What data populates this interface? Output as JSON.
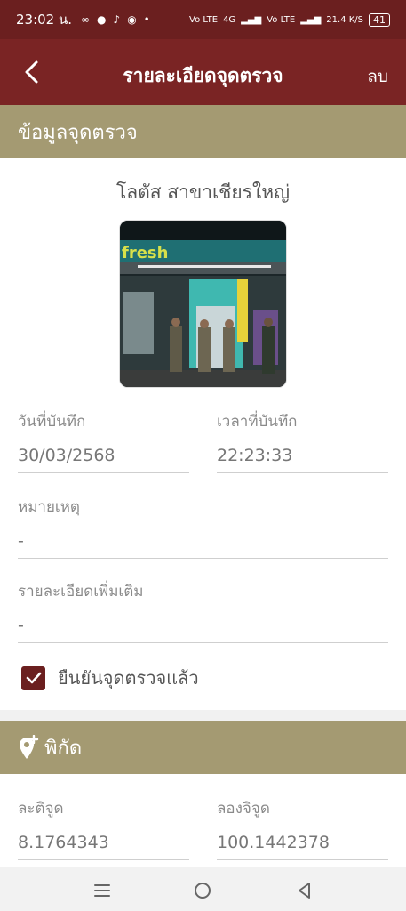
{
  "status_bar": {
    "time": "23:02 น.",
    "signal_text_1": "Vo LTE",
    "network": "4G",
    "signal_text_2": "Vo LTE",
    "speed": "21.4 K/S",
    "battery": "41",
    "notification_icons": [
      "infinity-icon",
      "line-icon",
      "tiktok-icon",
      "messenger-icon",
      "dot-icon"
    ]
  },
  "appbar": {
    "title": "รายละเอียดจุดตรวจ",
    "delete_label": "ลบ"
  },
  "checkpoint_section": {
    "header": "ข้อมูลจุดตรวจ",
    "place_name": "โลตัส  สาขาเชียรใหญ่",
    "photo_sign_text": "fresh",
    "date_label": "วันที่บันทึก",
    "date_value": "30/03/2568",
    "time_label": "เวลาที่บันทึก",
    "time_value": "22:23:33",
    "remark_label": "หมายเหตุ",
    "remark_value": "-",
    "details_label": "รายละเอียดเพิ่มเติม",
    "details_value": "-",
    "confirm_label": "ยืนยันจุดตรวจแล้ว",
    "confirm_checked": true
  },
  "location_section": {
    "header": "พิกัด",
    "lat_label": "ละติจูด",
    "lat_value": "8.1764343",
    "lng_label": "ลองจิจูด",
    "lng_value": "100.1442378"
  },
  "colors": {
    "appbar": "#7a2424",
    "statusbar": "#6b1f1f",
    "section_header": "#a49a72",
    "checkbox": "#6b1f1f"
  }
}
